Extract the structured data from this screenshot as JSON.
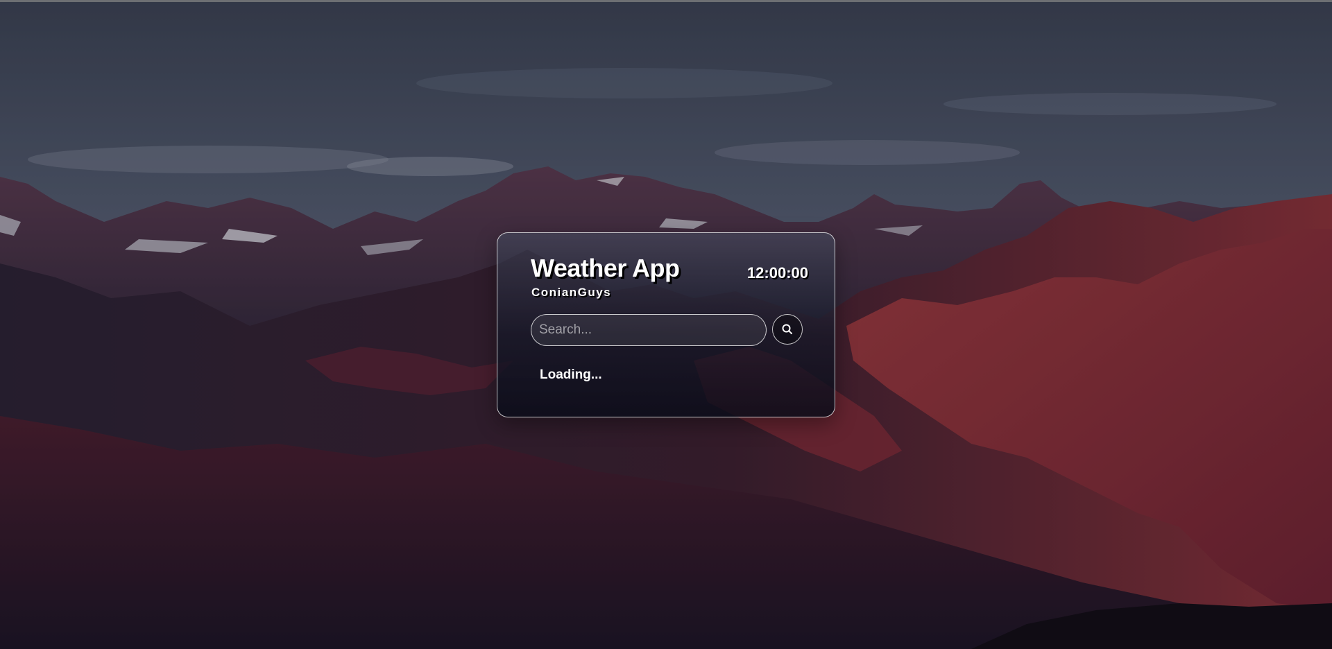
{
  "app": {
    "title": "Weather App",
    "subtitle": "ConianGuys",
    "clock": "12:00:00"
  },
  "search": {
    "placeholder": "Search...",
    "value": "",
    "button_icon": "search-icon"
  },
  "status": {
    "text": "Loading..."
  },
  "background": {
    "scene": "mountain-landscape",
    "sky_color": "#4a5468",
    "rock_color": "#7a2e36",
    "shadow_color": "#1a1626"
  }
}
